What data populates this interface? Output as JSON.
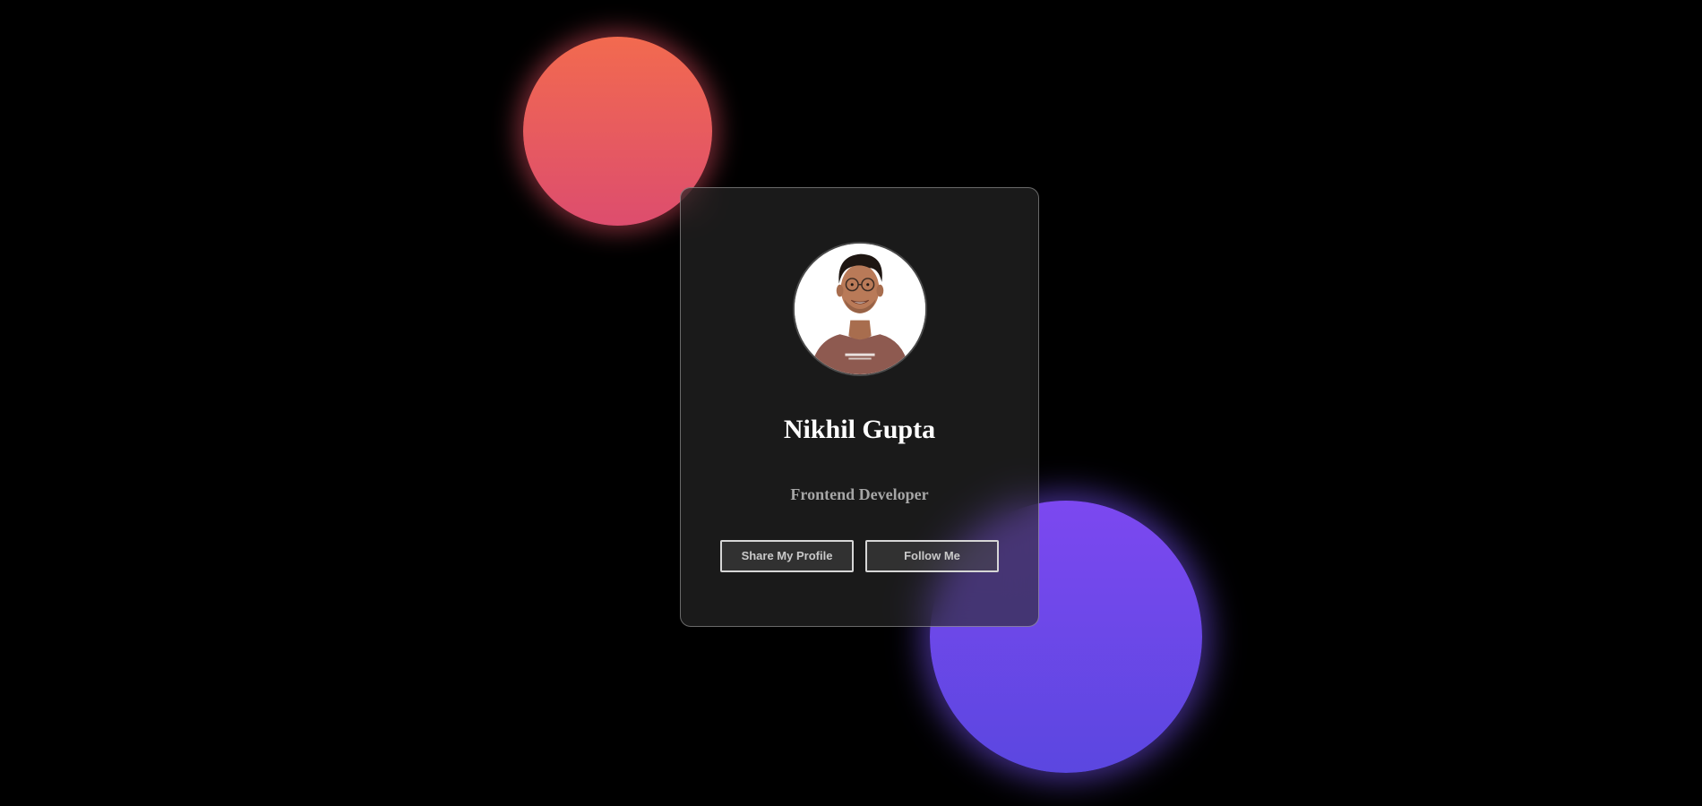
{
  "profile": {
    "name": "Nikhil Gupta",
    "role": "Frontend Developer",
    "avatar_alt": "Nikhil Gupta"
  },
  "buttons": {
    "share_label": "Share My Profile",
    "follow_label": "Follow Me"
  },
  "colors": {
    "background": "#000000",
    "orb_red_top": "#f26a4f",
    "orb_red_bottom": "#dd4d6e",
    "orb_purple_top": "#7c48f0",
    "orb_purple_bottom": "#5b47e0",
    "name_text": "#ffffff",
    "role_text": "#a6a6a6"
  }
}
